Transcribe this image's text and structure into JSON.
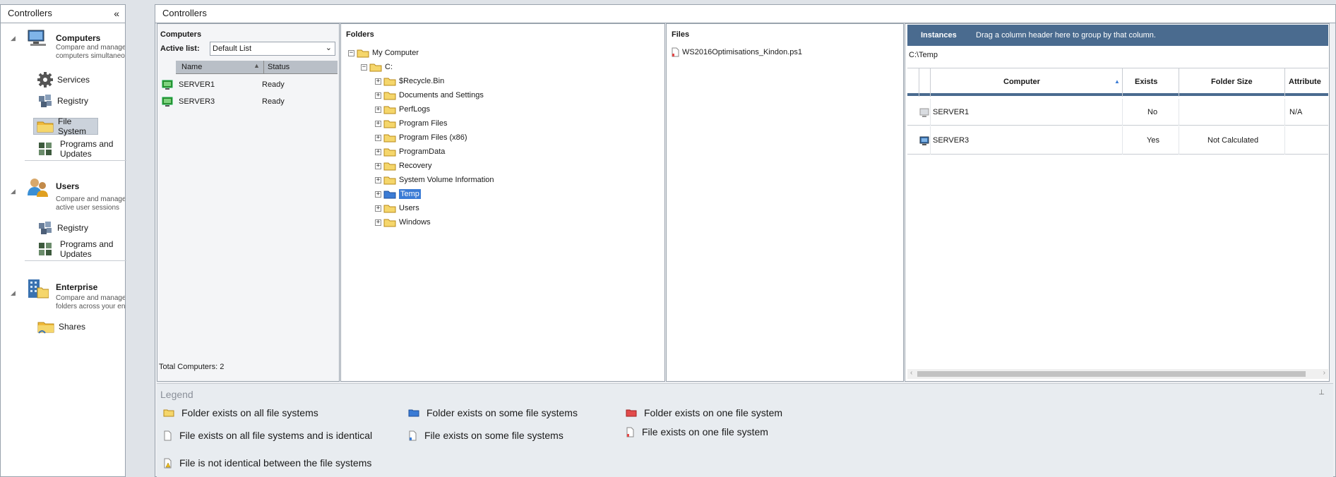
{
  "sidebar": {
    "header": "Controllers",
    "collapse": "«",
    "computers": {
      "title": "Computers",
      "desc1": "Compare and manage multiple",
      "desc2": "computers simultaneously",
      "items": [
        "Services",
        "Registry",
        "File System",
        "Programs and Updates"
      ]
    },
    "users": {
      "title": "Users",
      "desc1": "Compare and manage current",
      "desc2": "active user sessions",
      "items": [
        "Registry",
        "Programs and Updates"
      ]
    },
    "enterprise": {
      "title": "Enterprise",
      "desc1": "Compare and manage shared",
      "desc2": "folders across your enterprise",
      "items": [
        "Shares"
      ]
    }
  },
  "main": {
    "header": "Controllers"
  },
  "computers_panel": {
    "title": "Computers",
    "active_label": "Active list:",
    "active_value": "Default List",
    "col_name": "Name",
    "col_status": "Status",
    "rows": [
      {
        "name": "SERVER1",
        "status": "Ready"
      },
      {
        "name": "SERVER3",
        "status": "Ready"
      }
    ],
    "total": "Total Computers: 2"
  },
  "folders_panel": {
    "title": "Folders",
    "root": "My Computer",
    "drive": "C:",
    "items": [
      "$Recycle.Bin",
      "Documents and Settings",
      "PerfLogs",
      "Program Files",
      "Program Files (x86)",
      "ProgramData",
      "Recovery",
      "System Volume Information",
      "Temp",
      "Users",
      "Windows"
    ]
  },
  "files_panel": {
    "title": "Files",
    "items": [
      "WS2016Optimisations_Kindon.ps1"
    ]
  },
  "instances_panel": {
    "title": "Instances",
    "group_hint": "Drag a column header here to group by that column.",
    "path": "C:\\Temp",
    "columns": [
      "Computer",
      "Exists",
      "Folder Size",
      "Attribute"
    ],
    "rows": [
      {
        "computer": "SERVER1",
        "exists": "No",
        "size": "",
        "attr": "N/A"
      },
      {
        "computer": "SERVER3",
        "exists": "Yes",
        "size": "Not Calculated",
        "attr": ""
      }
    ]
  },
  "legend": {
    "title": "Legend",
    "pin": "⊥",
    "items": [
      "Folder exists on all file systems",
      "Folder exists on some file systems",
      "Folder exists on one file system",
      "File exists on all file systems and is identical",
      "File exists on some file systems",
      "File exists on one file system",
      "File is not identical between the file systems"
    ]
  },
  "colors": {
    "accent": "#4a6b8f",
    "selected": "#3a7bd5",
    "folder": "#f5d66b",
    "blue": "#3a7bd5",
    "red": "#e24b4b"
  }
}
